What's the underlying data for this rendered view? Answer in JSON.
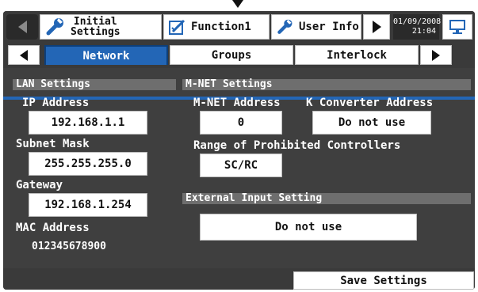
{
  "header": {
    "tabs": {
      "initial_line1": "Initial",
      "initial_line2": "Settings",
      "function1": "Function1",
      "user_info": "User Info"
    },
    "date": "01/09/2008",
    "time": "21:04"
  },
  "subtabs": {
    "network": "Network",
    "groups": "Groups",
    "interlock": "Interlock",
    "active": "Network"
  },
  "lan": {
    "title": "LAN Settings",
    "ip_label": "IP Address",
    "ip_value": "192.168.1.1",
    "subnet_label": "Subnet Mask",
    "subnet_value": "255.255.255.0",
    "gateway_label": "Gateway",
    "gateway_value": "192.168.1.254",
    "mac_label": "MAC Address",
    "mac_value": "012345678900"
  },
  "mnet": {
    "title": "M-NET Settings",
    "address_label": "M-NET Address",
    "address_value": "0",
    "kconv_label": "K Converter Address",
    "kconv_value": "Do not use",
    "range_label": "Range of Prohibited Controllers",
    "range_value": "SC/RC"
  },
  "external": {
    "title": "External Input Setting",
    "value": "Do not use"
  },
  "footer": {
    "save_label": "Save Settings"
  },
  "colors": {
    "active_tab": "#2366b6",
    "background": "#3f3f3f",
    "section_bar": "#6e6e6e",
    "wrench_icon": "#2366b6"
  },
  "icons": {
    "back": "triangle-left-icon",
    "settings": "wrench-icon",
    "function": "pencil-check-icon",
    "user": "wrench-icon",
    "next": "triangle-right-icon",
    "monitor": "monitor-icon"
  }
}
